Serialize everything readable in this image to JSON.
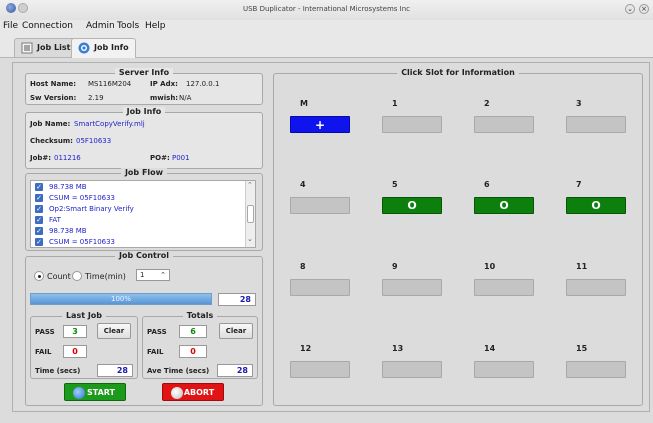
{
  "window": {
    "title": "USB Duplicator - International Microsystems Inc"
  },
  "menu": [
    "File",
    "Connection",
    "Admin",
    "Tools",
    "Help"
  ],
  "tabs": [
    {
      "label": "Job List",
      "icon": "list-icon"
    },
    {
      "label": "Job Info",
      "icon": "info-icon"
    }
  ],
  "server_info": {
    "title": "Server Info",
    "host_label": "Host Name:",
    "host": "MS116M204",
    "ip_label": "IP Adx:",
    "ip": "127.0.0.1",
    "sw_label": "Sw Version:",
    "sw": "2.19",
    "mwish_label": "mwish:",
    "mwish": "N/A"
  },
  "job_info": {
    "title": "Job Info",
    "name_label": "Job Name:",
    "name": "SmartCopyVerify.mlj",
    "checksum_label": "Checksum:",
    "checksum": "05F10633",
    "jobno_label": "Job#:",
    "jobno": "011216",
    "po_label": "PO#:",
    "po": "P001"
  },
  "job_flow": {
    "title": "Job Flow",
    "items": [
      "98.738 MB",
      "CSUM = 05F10633",
      "Op2:Smart Binary Verify",
      "FAT",
      "98.738 MB",
      "CSUM = 05F10633"
    ]
  },
  "job_control": {
    "title": "Job Control",
    "mode_count": "Count",
    "mode_time": "Time(min)",
    "count_value": "1",
    "progress_label": "100%",
    "progress_fraction": 1.0,
    "progress_count": "28",
    "last_job": {
      "title": "Last Job",
      "pass_label": "PASS",
      "pass": "3",
      "fail_label": "FAIL",
      "fail": "0",
      "time_label": "Time (secs)",
      "time": "28",
      "clear": "Clear"
    },
    "totals": {
      "title": "Totals",
      "pass_label": "PASS",
      "pass": "6",
      "fail_label": "FAIL",
      "fail": "0",
      "time_label": "Ave Time (secs)",
      "time": "28",
      "clear": "Clear"
    },
    "start": "START",
    "abort": "ABORT"
  },
  "slots_panel": {
    "title": "Click Slot for Information",
    "slots": [
      {
        "label": "M",
        "text": "+",
        "state": "master"
      },
      {
        "label": "1",
        "text": "",
        "state": "empty"
      },
      {
        "label": "2",
        "text": "",
        "state": "empty"
      },
      {
        "label": "3",
        "text": "",
        "state": "empty"
      },
      {
        "label": "4",
        "text": "",
        "state": "empty"
      },
      {
        "label": "5",
        "text": "O",
        "state": "ok"
      },
      {
        "label": "6",
        "text": "O",
        "state": "ok"
      },
      {
        "label": "7",
        "text": "O",
        "state": "ok"
      },
      {
        "label": "8",
        "text": "",
        "state": "empty"
      },
      {
        "label": "9",
        "text": "",
        "state": "empty"
      },
      {
        "label": "10",
        "text": "",
        "state": "empty"
      },
      {
        "label": "11",
        "text": "",
        "state": "empty"
      },
      {
        "label": "12",
        "text": "",
        "state": "empty"
      },
      {
        "label": "13",
        "text": "",
        "state": "empty"
      },
      {
        "label": "14",
        "text": "",
        "state": "empty"
      },
      {
        "label": "15",
        "text": "",
        "state": "empty"
      }
    ]
  },
  "colors": {
    "master": "#0f14ee",
    "ok": "#0d7f0d",
    "empty": "#c4c4c4",
    "start": "#1c9a1c",
    "abort": "#e01414"
  }
}
